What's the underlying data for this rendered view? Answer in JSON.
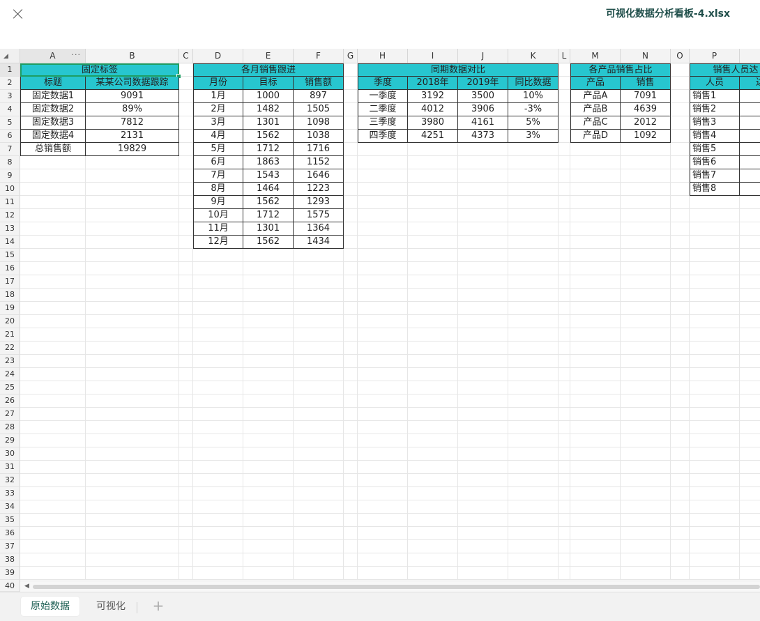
{
  "window": {
    "title": "可视化数据分析看板-4.xlsx"
  },
  "columns": [
    "A",
    "B",
    "C",
    "D",
    "E",
    "F",
    "G",
    "H",
    "I",
    "J",
    "K",
    "L",
    "M",
    "N",
    "O",
    "P",
    ""
  ],
  "rows": [
    "1",
    "2",
    "3",
    "4",
    "5",
    "6",
    "7",
    "8",
    "9",
    "10",
    "11",
    "12",
    "13",
    "14",
    "15",
    "16",
    "17",
    "18",
    "19",
    "20",
    "21",
    "22",
    "23",
    "24",
    "25",
    "26",
    "27",
    "28",
    "29",
    "30",
    "31",
    "32",
    "33",
    "34",
    "35",
    "36",
    "37",
    "38",
    "39",
    "40"
  ],
  "colors": {
    "header_fill": "#27c6cf",
    "selection": "#1e9e63",
    "title": "#1f4e4a"
  },
  "tables": {
    "fixed": {
      "title": "固定标签",
      "headers": [
        "标题",
        "某某公司数据跟踪"
      ],
      "rows": [
        [
          "固定数据1",
          "9091"
        ],
        [
          "固定数据2",
          "89%"
        ],
        [
          "固定数据3",
          "7812"
        ],
        [
          "固定数据4",
          "2131"
        ],
        [
          "总销售额",
          "19829"
        ]
      ]
    },
    "monthly": {
      "title": "各月销售跟进",
      "headers": [
        "月份",
        "目标",
        "销售额"
      ],
      "rows": [
        [
          "1月",
          "1000",
          "897"
        ],
        [
          "2月",
          "1482",
          "1505"
        ],
        [
          "3月",
          "1301",
          "1098"
        ],
        [
          "4月",
          "1562",
          "1038"
        ],
        [
          "5月",
          "1712",
          "1716"
        ],
        [
          "6月",
          "1863",
          "1152"
        ],
        [
          "7月",
          "1543",
          "1646"
        ],
        [
          "8月",
          "1464",
          "1223"
        ],
        [
          "9月",
          "1562",
          "1293"
        ],
        [
          "10月",
          "1712",
          "1575"
        ],
        [
          "11月",
          "1301",
          "1364"
        ],
        [
          "12月",
          "1562",
          "1434"
        ]
      ]
    },
    "yoy": {
      "title": "同期数据对比",
      "headers": [
        "季度",
        "2018年",
        "2019年",
        "同比数据"
      ],
      "rows": [
        [
          "一季度",
          "3192",
          "3500",
          "10%"
        ],
        [
          "二季度",
          "4012",
          "3906",
          "-3%"
        ],
        [
          "三季度",
          "3980",
          "4161",
          "5%"
        ],
        [
          "四季度",
          "4251",
          "4373",
          "3%"
        ]
      ]
    },
    "product": {
      "title": "各产品销售占比",
      "headers": [
        "产品",
        "销售"
      ],
      "rows": [
        [
          "产品A",
          "7091"
        ],
        [
          "产品B",
          "4639"
        ],
        [
          "产品C",
          "2012"
        ],
        [
          "产品D",
          "1092"
        ]
      ]
    },
    "staff": {
      "title": "销售人员达",
      "headers": [
        "人员",
        "达"
      ],
      "rows": [
        [
          "销售1",
          ""
        ],
        [
          "销售2",
          ""
        ],
        [
          "销售3",
          ""
        ],
        [
          "销售4",
          ""
        ],
        [
          "销售5",
          ""
        ],
        [
          "销售6",
          ""
        ],
        [
          "销售7",
          ""
        ],
        [
          "销售8",
          ""
        ]
      ]
    }
  },
  "sheets": [
    "原始数据",
    "可视化"
  ],
  "add_sheet": "+"
}
